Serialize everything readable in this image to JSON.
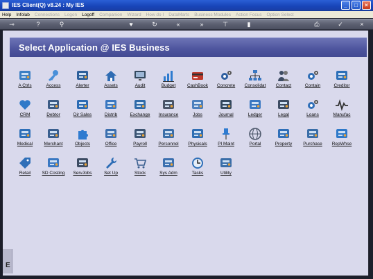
{
  "window": {
    "title": "IES Client(Q) v8.24 : My IES",
    "minimize": "_",
    "maximize": "□",
    "close": "×"
  },
  "menu": {
    "items": [
      {
        "label": "Help",
        "disabled": false
      },
      {
        "label": "Infolab",
        "disabled": false
      },
      {
        "label": "Connections",
        "disabled": true
      },
      {
        "label": "Logon",
        "disabled": true
      },
      {
        "label": "Logoff",
        "disabled": false
      },
      {
        "label": "Companion",
        "disabled": true
      },
      {
        "label": "Wizard",
        "disabled": true
      },
      {
        "label": "How do I",
        "disabled": true
      },
      {
        "label": "DataMarts",
        "disabled": true
      },
      {
        "label": "Business Modules",
        "disabled": true
      },
      {
        "label": "Action Focus",
        "disabled": true
      },
      {
        "label": "Option Select",
        "disabled": true
      }
    ]
  },
  "toolbar": {
    "icons": [
      "key-icon",
      "help-icon",
      "search-icon",
      "heart-icon",
      "refresh-icon",
      "rewind-icon",
      "fast-forward-icon",
      "pin-icon",
      "stop-icon",
      "printer-icon",
      "check-icon",
      "close-icon"
    ],
    "glyphs": [
      "⊸",
      "?",
      "⚲",
      "♥",
      "↻",
      "«",
      "»",
      "⊤",
      "▮",
      "⎙",
      "✓",
      "×"
    ]
  },
  "main": {
    "header_title": "Select Application @ IES Business",
    "left_marker": "E"
  },
  "apps": [
    {
      "label": "A Ctrls",
      "icon": "access-control-icon",
      "color": "#3b7fc4"
    },
    {
      "label": "Access",
      "icon": "key-icon",
      "color": "#4a90d9"
    },
    {
      "label": "Alerter",
      "icon": "alert-device-icon",
      "color": "#2c5f9a"
    },
    {
      "label": "Assets",
      "icon": "house-icon",
      "color": "#2f6cb3"
    },
    {
      "label": "Audit",
      "icon": "monitor-icon",
      "color": "#34495e"
    },
    {
      "label": "Budget",
      "icon": "bar-chart-icon",
      "color": "#2e7bcf"
    },
    {
      "label": "CashBook",
      "icon": "credit-card-icon",
      "color": "#c0392b"
    },
    {
      "label": "Concrete",
      "icon": "gears-icon",
      "color": "#2f5f9f"
    },
    {
      "label": "Consolidat",
      "icon": "org-chart-icon",
      "color": "#3a78c2"
    },
    {
      "label": "Contact",
      "icon": "people-icon",
      "color": "#3d4c63"
    },
    {
      "label": "Contain",
      "icon": "gears-icon",
      "color": "#2d6db5"
    },
    {
      "label": "Creditor",
      "icon": "wallet-icon",
      "color": "#2c6fb8"
    },
    {
      "label": "CRM",
      "icon": "heart-icon",
      "color": "#2f79c8"
    },
    {
      "label": "Debtor",
      "icon": "person-card-icon",
      "color": "#3b5b85"
    },
    {
      "label": "Dir Sales",
      "icon": "cash-register-icon",
      "color": "#2b6bb3"
    },
    {
      "label": "Distrib",
      "icon": "truck-icon",
      "color": "#3a77c0"
    },
    {
      "label": "Exchange",
      "icon": "exchange-icon",
      "color": "#2f6aa8"
    },
    {
      "label": "Insurance",
      "icon": "document-icon",
      "color": "#4a5568"
    },
    {
      "label": "Jobs",
      "icon": "forms-icon",
      "color": "#4a7fbd"
    },
    {
      "label": "Journal",
      "icon": "calculator-icon",
      "color": "#34495e"
    },
    {
      "label": "Ledger",
      "icon": "pen-paper-icon",
      "color": "#3a78c2"
    },
    {
      "label": "Legal",
      "icon": "scales-icon",
      "color": "#3d4c63"
    },
    {
      "label": "Loans",
      "icon": "gears-icon",
      "color": "#2f6fb8"
    },
    {
      "label": "Manufac",
      "icon": "pulse-icon",
      "color": "#333333"
    },
    {
      "label": "Medical",
      "icon": "medical-folder-icon",
      "color": "#2d6fb8"
    },
    {
      "label": "Merchant",
      "icon": "handshake-icon",
      "color": "#3a5f8f"
    },
    {
      "label": "Objects",
      "icon": "puzzle-icon",
      "color": "#2f7bd0"
    },
    {
      "label": "Office",
      "icon": "office-tools-icon",
      "color": "#3b6fae"
    },
    {
      "label": "Payroll",
      "icon": "payroll-icon",
      "color": "#3d5573"
    },
    {
      "label": "Personnel",
      "icon": "person-laptop-icon",
      "color": "#3a6ea8"
    },
    {
      "label": "Physicals",
      "icon": "devices-icon",
      "color": "#2e6db3"
    },
    {
      "label": "PI Maint",
      "icon": "pushpin-icon",
      "color": "#2f7bd0"
    },
    {
      "label": "Portal",
      "icon": "globe-icon",
      "color": "#4a5568"
    },
    {
      "label": "Property",
      "icon": "test-tubes-icon",
      "color": "#2f6fb8"
    },
    {
      "label": "Purchase",
      "icon": "purchase-icon",
      "color": "#3a6ea8"
    },
    {
      "label": "RepWhse",
      "icon": "card-stack-icon",
      "color": "#2e79c9"
    },
    {
      "label": "Retail",
      "icon": "price-tag-icon",
      "color": "#2f6fb8"
    },
    {
      "label": "SD Costing",
      "icon": "cash-icon",
      "color": "#3a78c2"
    },
    {
      "label": "ServJobs",
      "icon": "service-device-icon",
      "color": "#3d4c63"
    },
    {
      "label": "Set Up",
      "icon": "wrench-icon",
      "color": "#2d6db5"
    },
    {
      "label": "Stock",
      "icon": "cart-icon",
      "color": "#3a5f8f"
    },
    {
      "label": "Sys Adm",
      "icon": "admin-icon",
      "color": "#3b6fae"
    },
    {
      "label": "Tasks",
      "icon": "clock-icon",
      "color": "#2f6fb8"
    },
    {
      "label": "Utility",
      "icon": "utility-icon",
      "color": "#3a6ea8"
    }
  ]
}
